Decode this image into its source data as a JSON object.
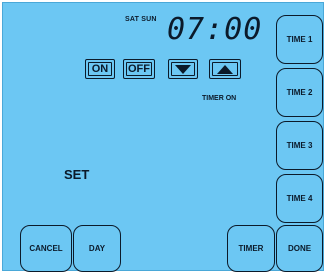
{
  "header": {
    "days": "SAT SUN",
    "time": "07:00"
  },
  "controls": {
    "on_label": "ON",
    "off_label": "OFF"
  },
  "status": {
    "timer_state": "TIMER ON",
    "mode": "SET"
  },
  "side_buttons": [
    "TIME 1",
    "TIME 2",
    "TIME 3",
    "TIME 4",
    "DONE"
  ],
  "bottom_buttons": {
    "cancel": "CANCEL",
    "day": "DAY",
    "timer": "TIMER"
  },
  "colors": {
    "screen": "#6cc7f3",
    "ink": "#0b1a2a"
  }
}
